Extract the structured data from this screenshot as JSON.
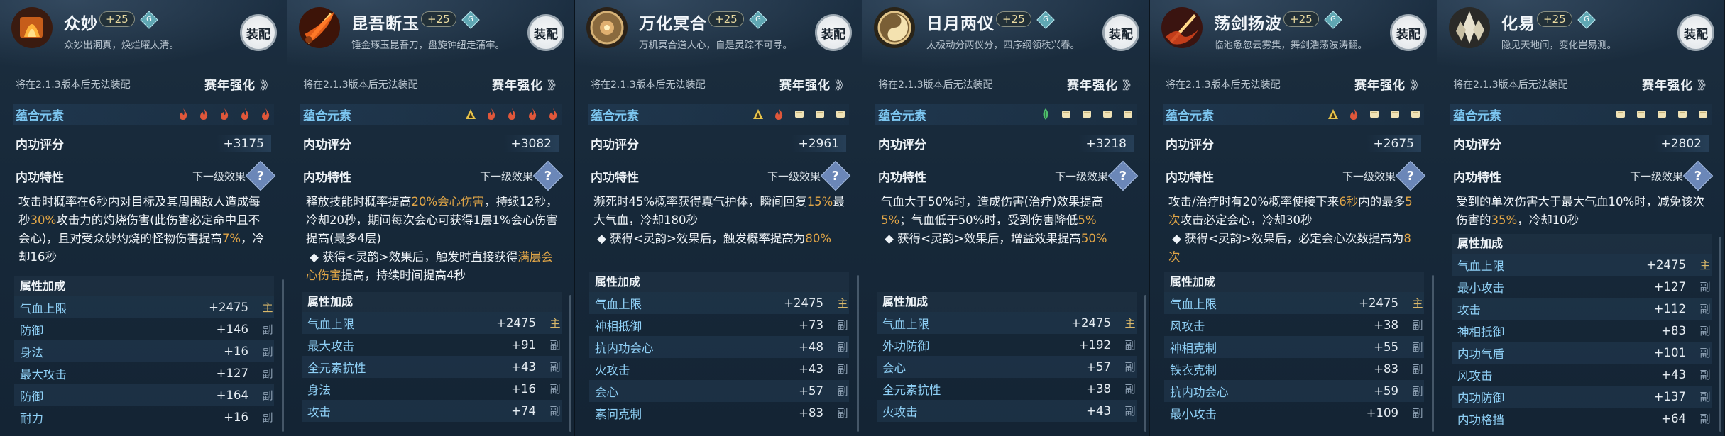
{
  "common": {
    "level_badge": "+25",
    "gem_glyph": "G",
    "equip_label": "装配",
    "warning": "将在2.1.3版本后无法装配",
    "season_label": "赛年强化",
    "season_chevrons": "》》",
    "elements_label": "蕴合元素",
    "score_label": "内功评分",
    "trait_label": "内功特性",
    "next_level_label": "下一级效果",
    "help_glyph": "?",
    "attr_header": "属性加成",
    "main_tag": "主",
    "sub_tag": "副"
  },
  "colors": {
    "highlight": "#e0a547",
    "attr_name": "#8fd0f6",
    "elements_label": "#7cc6f0"
  },
  "panels": [
    {
      "title": "众妙",
      "desc": "众妙出洞真，焕烂曜太清。",
      "icon": "flame-scroll-icon",
      "elements": [
        "fire",
        "fire",
        "fire",
        "fire",
        "fire"
      ],
      "score": "+3175",
      "effect": [
        {
          "t": "攻击时概率在6秒内对目标及其周围敌人造成每秒"
        },
        {
          "t": "30%",
          "h": true
        },
        {
          "t": "攻击力的灼烧伤害(此伤害必定命中且不会心)，且对受众妙灼烧的怪物伤害提高"
        },
        {
          "t": "7%",
          "h": true
        },
        {
          "t": "，冷却16秒"
        }
      ],
      "attrs": [
        {
          "name": "气血上限",
          "value": "+2475",
          "tag": "主"
        },
        {
          "name": "防御",
          "value": "+146",
          "tag": "副"
        },
        {
          "name": "身法",
          "value": "+16",
          "tag": "副"
        },
        {
          "name": "最大攻击",
          "value": "+127",
          "tag": "副"
        },
        {
          "name": "防御",
          "value": "+164",
          "tag": "副"
        },
        {
          "name": "耐力",
          "value": "+16",
          "tag": "副"
        }
      ]
    },
    {
      "title": "昆吾断玉",
      "desc": "锤金琢玉昆吾刀，盘旋钟纽走蒲牢。",
      "icon": "flaming-sword-icon",
      "elements": [
        "earth",
        "fire",
        "fire",
        "fire",
        "fire"
      ],
      "score": "+3082",
      "effect": [
        {
          "t": "释放技能时概率提高"
        },
        {
          "t": "20%会心伤害",
          "h": true
        },
        {
          "t": "，持续12秒，冷却20秒，期间每次会心可获得1层1%会心伤害提高(最多4层)\n ◆ 获得<灵韵>效果后，触发时直接获得"
        },
        {
          "t": "满层会心伤害",
          "h": true
        },
        {
          "t": "提高，持续时间提高4秒"
        }
      ],
      "attrs": [
        {
          "name": "气血上限",
          "value": "+2475",
          "tag": "主"
        },
        {
          "name": "最大攻击",
          "value": "+91",
          "tag": "副"
        },
        {
          "name": "全元素抗性",
          "value": "+43",
          "tag": "副"
        },
        {
          "name": "身法",
          "value": "+16",
          "tag": "副"
        },
        {
          "name": "攻击",
          "value": "+74",
          "tag": "副"
        }
      ]
    },
    {
      "title": "万化冥合",
      "desc": "万机冥合道人心，自是灵踪不可寻。",
      "icon": "bronze-orb-icon",
      "elements": [
        "earth",
        "fire",
        "scroll",
        "scroll",
        "scroll"
      ],
      "score": "+2961",
      "effect": [
        {
          "t": "濒死时45%概率获得真气护体，瞬间回复"
        },
        {
          "t": "15%",
          "h": true
        },
        {
          "t": "最大气血，冷却180秒\n ◆ 获得<灵韵>效果后，触发概率提高为"
        },
        {
          "t": "80%",
          "h": true
        }
      ],
      "attrs": [
        {
          "name": "气血上限",
          "value": "+2475",
          "tag": "主"
        },
        {
          "name": "神相抵御",
          "value": "+73",
          "tag": "副"
        },
        {
          "name": "抗内功会心",
          "value": "+48",
          "tag": "副"
        },
        {
          "name": "火攻击",
          "value": "+43",
          "tag": "副"
        },
        {
          "name": "会心",
          "value": "+57",
          "tag": "副"
        },
        {
          "name": "素问克制",
          "value": "+83",
          "tag": "副"
        }
      ]
    },
    {
      "title": "日月两仪",
      "desc": "太极动分两仪分，四序纲领秩兴春。",
      "icon": "sun-moon-disc-icon",
      "elements": [
        "wood",
        "scroll",
        "scroll",
        "scroll",
        "scroll"
      ],
      "score": "+3218",
      "effect": [
        {
          "t": "气血大于50%时，造成伤害(治疗)效果提高"
        },
        {
          "t": "5%",
          "h": true
        },
        {
          "t": "；气血低于50%时，受到伤害降低"
        },
        {
          "t": "5%",
          "h": true
        },
        {
          "t": "\n ◆ 获得<灵韵>效果后，增益效果提高"
        },
        {
          "t": "50%",
          "h": true
        }
      ],
      "attrs": [
        {
          "name": "气血上限",
          "value": "+2475",
          "tag": "主"
        },
        {
          "name": "外功防御",
          "value": "+192",
          "tag": "副"
        },
        {
          "name": "会心",
          "value": "+57",
          "tag": "副"
        },
        {
          "name": "全元素抗性",
          "value": "+38",
          "tag": "副"
        },
        {
          "name": "火攻击",
          "value": "+43",
          "tag": "副"
        }
      ]
    },
    {
      "title": "荡剑扬波",
      "desc": "临池惫忽云雾集，舞剑浩荡波涛翻。",
      "icon": "sword-wave-icon",
      "elements": [
        "earth",
        "fire",
        "scroll",
        "scroll",
        "scroll"
      ],
      "score": "+2675",
      "effect": [
        {
          "t": "攻击/治疗时有20%概率使接下来"
        },
        {
          "t": "6秒",
          "h": true
        },
        {
          "t": "内的最多"
        },
        {
          "t": "5次",
          "h": true
        },
        {
          "t": "攻击必定会心，冷却30秒\n ◆ 获得<灵韵>效果后，必定会心次数提高为"
        },
        {
          "t": "8次",
          "h": true
        }
      ],
      "attrs": [
        {
          "name": "气血上限",
          "value": "+2475",
          "tag": "主"
        },
        {
          "name": "风攻击",
          "value": "+38",
          "tag": "副"
        },
        {
          "name": "神相克制",
          "value": "+55",
          "tag": "副"
        },
        {
          "name": "铁衣克制",
          "value": "+83",
          "tag": "副"
        },
        {
          "name": "抗内功会心",
          "value": "+59",
          "tag": "副"
        },
        {
          "name": "最小攻击",
          "value": "+109",
          "tag": "副"
        }
      ]
    },
    {
      "title": "化易",
      "desc": "隐见天地间，变化岂易测。",
      "icon": "crystal-cluster-icon",
      "elements": [
        "scroll",
        "scroll",
        "scroll",
        "scroll",
        "scroll"
      ],
      "score": "+2802",
      "effect": [
        {
          "t": "受到的单次伤害大于最大气血10%时，减免该次伤害的"
        },
        {
          "t": "35%",
          "h": true
        },
        {
          "t": "，冷却10秒"
        }
      ],
      "attrs": [
        {
          "name": "气血上限",
          "value": "+2475",
          "tag": "主"
        },
        {
          "name": "最小攻击",
          "value": "+127",
          "tag": "副"
        },
        {
          "name": "攻击",
          "value": "+112",
          "tag": "副"
        },
        {
          "name": "神相抵御",
          "value": "+83",
          "tag": "副"
        },
        {
          "name": "内功气盾",
          "value": "+101",
          "tag": "副"
        },
        {
          "name": "风攻击",
          "value": "+43",
          "tag": "副"
        },
        {
          "name": "内功防御",
          "value": "+137",
          "tag": "副"
        },
        {
          "name": "内功格挡",
          "value": "+64",
          "tag": "副"
        }
      ]
    }
  ]
}
